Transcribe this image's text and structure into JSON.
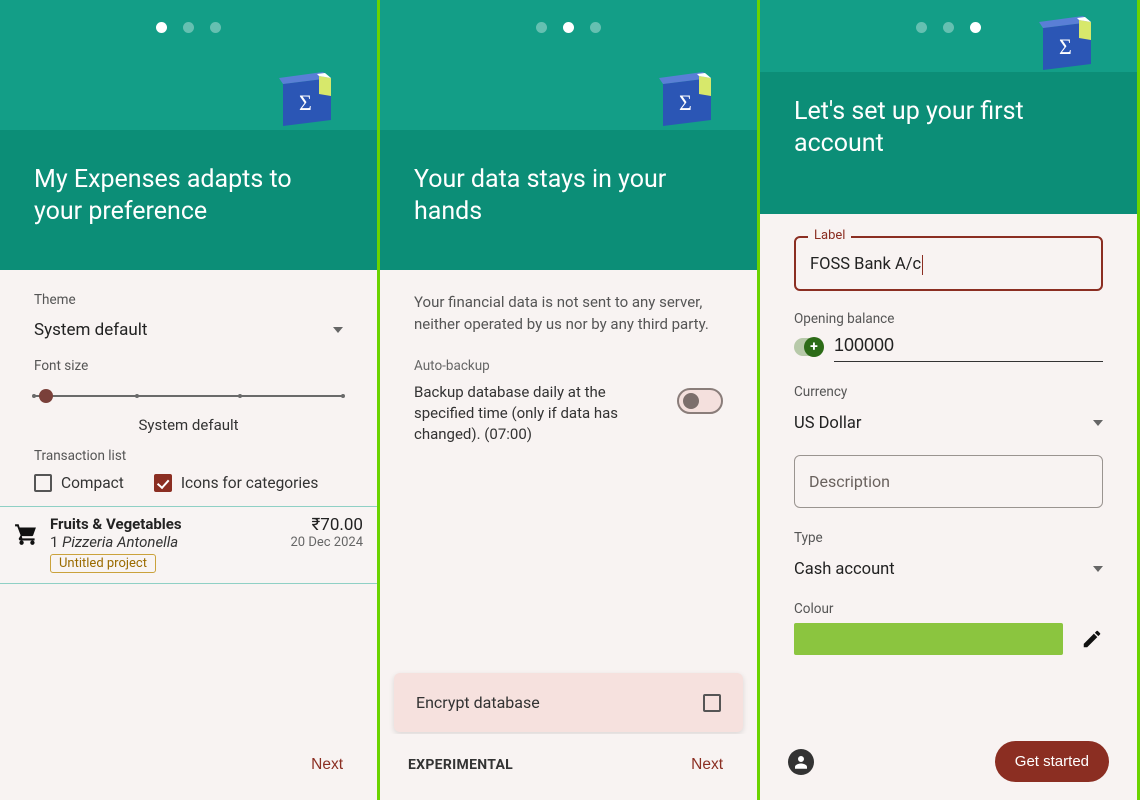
{
  "pane1": {
    "dots_active": 0,
    "title": "My Expenses adapts to your preference",
    "theme_label": "Theme",
    "theme_value": "System default",
    "font_label": "Font size",
    "font_caption": "System default",
    "tx_list_label": "Transaction list",
    "check_compact": "Compact",
    "check_icons": "Icons for categories",
    "tx": {
      "category": "Fruits & Vegetables",
      "count": "1",
      "merchant": "Pizzeria Antonella",
      "chip": "Untitled project",
      "amount": "₹70.00",
      "date": "20 Dec 2024"
    },
    "next": "Next"
  },
  "pane2": {
    "dots_active": 1,
    "title": "Your data stays in your hands",
    "desc": "Your financial data is not sent to any server, neither operated by us nor by any third party.",
    "autobackup_label": "Auto-backup",
    "autobackup_text": "Backup database daily at the specified time (only if data has changed). (07:00)",
    "encrypt_label": "Encrypt database",
    "experimental": "EXPERIMENTAL",
    "next": "Next"
  },
  "pane3": {
    "dots_active": 2,
    "title": "Let's set up your first account",
    "label_field": "Label",
    "label_value": "FOSS Bank A/c",
    "ob_label": "Opening balance",
    "ob_value": "100000",
    "currency_label": "Currency",
    "currency_value": "US Dollar",
    "description_placeholder": "Description",
    "type_label": "Type",
    "type_value": "Cash account",
    "colour_label": "Colour",
    "colour_value": "#8bc53f",
    "cta": "Get started"
  }
}
